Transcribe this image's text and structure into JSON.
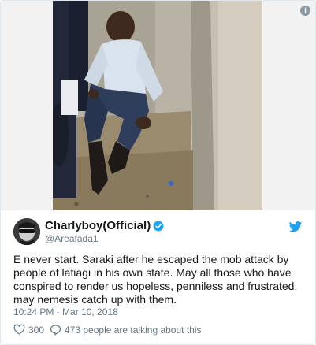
{
  "tweet": {
    "display_name": "Charlyboy(Official)",
    "handle": "@Areafada1",
    "text": "E never start.  Saraki after he escaped the mob attack by people of lafiagi in his own state.  May all those who have conspired to render us hopeless, penniless and frustrated, may nemesis catch up with them.",
    "timestamp": "10:24 PM - Mar 10, 2018",
    "likes": "300",
    "conversation": "473 people are talking about this"
  },
  "icons": {
    "info": "info-icon",
    "verified": "verified-badge-icon",
    "logo": "twitter-bird-icon",
    "like": "heart-icon",
    "reply": "speech-bubble-icon"
  },
  "colors": {
    "brand_blue": "#1da1f2",
    "secondary_text": "#657786",
    "primary_text": "#14171a",
    "border": "#e1e8ed"
  }
}
